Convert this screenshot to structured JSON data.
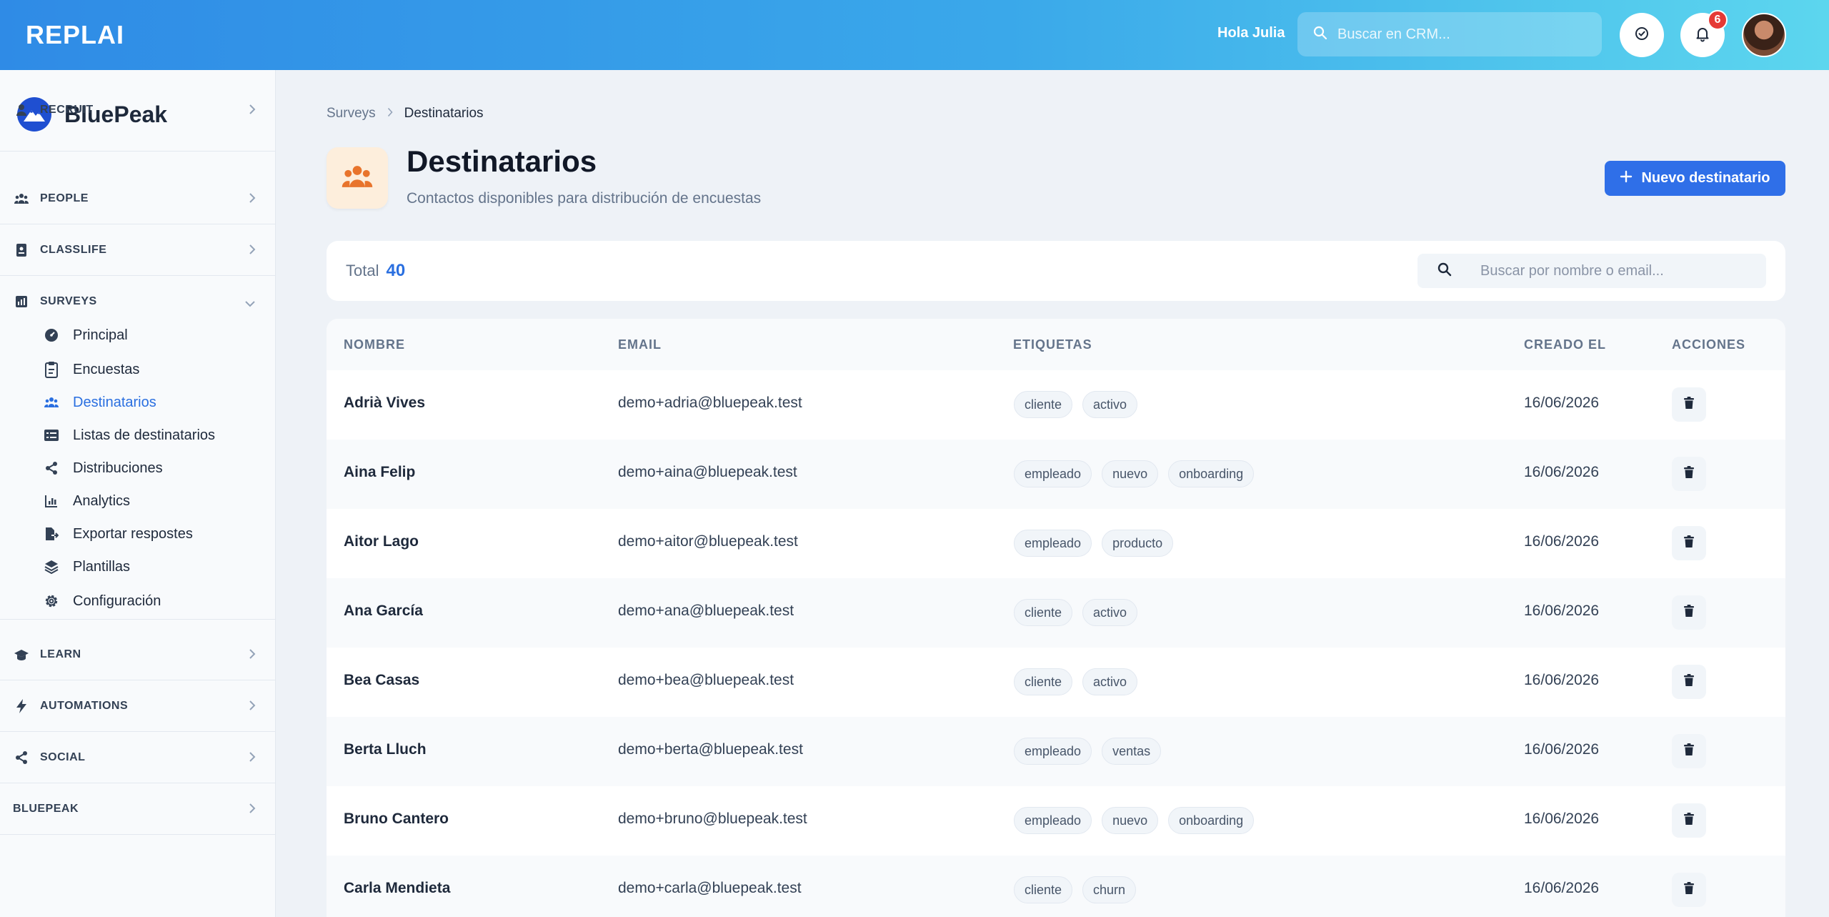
{
  "app": {
    "logo": "REPLAI",
    "greeting": "Hola Julia",
    "search_placeholder": "Buscar en CRM...",
    "notification_count": "6"
  },
  "brand": {
    "name": "BluePeak"
  },
  "sidebar": {
    "sections": [
      {
        "label": "RECRUIT",
        "icon": "user-tie-icon"
      },
      {
        "label": "PEOPLE",
        "icon": "people-group-icon"
      },
      {
        "label": "CLASSLIFE",
        "icon": "id-badge-icon"
      },
      {
        "label": "SURVEYS",
        "icon": "bar-chart-icon",
        "expanded": true
      },
      {
        "label": "LEARN",
        "icon": "graduation-cap-icon"
      },
      {
        "label": "AUTOMATIONS",
        "icon": "bolt-icon"
      },
      {
        "label": "SOCIAL",
        "icon": "share-icon"
      },
      {
        "label": "BLUEPEAK",
        "icon": ""
      }
    ],
    "survey_items": [
      {
        "label": "Principal",
        "icon": "gauge-icon"
      },
      {
        "label": "Encuestas",
        "icon": "clipboard-icon"
      },
      {
        "label": "Destinatarios",
        "icon": "people-group-icon",
        "active": true
      },
      {
        "label": "Listas de destinatarios",
        "icon": "list-icon"
      },
      {
        "label": "Distribuciones",
        "icon": "share-icon"
      },
      {
        "label": "Analytics",
        "icon": "chart-icon"
      },
      {
        "label": "Exportar respostes",
        "icon": "file-export-icon"
      },
      {
        "label": "Plantillas",
        "icon": "layers-icon"
      },
      {
        "label": "Configuración",
        "icon": "gear-icon"
      }
    ]
  },
  "breadcrumb": {
    "parent": "Surveys",
    "current": "Destinatarios"
  },
  "page": {
    "title": "Destinatarios",
    "subtitle": "Contactos disponibles para distribución de encuestas",
    "new_button": "Nuevo destinatario"
  },
  "toolbar": {
    "total_label": "Total",
    "total_value": "40",
    "search_placeholder": "Buscar por nombre o email..."
  },
  "table": {
    "headers": [
      "NOMBRE",
      "EMAIL",
      "ETIQUETAS",
      "CREADO EL",
      "ACCIONES"
    ],
    "rows": [
      {
        "name": "Adrià Vives",
        "email": "demo+adria@bluepeak.test",
        "tags": [
          "cliente",
          "activo"
        ],
        "created": "16/06/2026"
      },
      {
        "name": "Aina Felip",
        "email": "demo+aina@bluepeak.test",
        "tags": [
          "empleado",
          "nuevo",
          "onboarding"
        ],
        "created": "16/06/2026"
      },
      {
        "name": "Aitor Lago",
        "email": "demo+aitor@bluepeak.test",
        "tags": [
          "empleado",
          "producto"
        ],
        "created": "16/06/2026"
      },
      {
        "name": "Ana García",
        "email": "demo+ana@bluepeak.test",
        "tags": [
          "cliente",
          "activo"
        ],
        "created": "16/06/2026"
      },
      {
        "name": "Bea Casas",
        "email": "demo+bea@bluepeak.test",
        "tags": [
          "cliente",
          "activo"
        ],
        "created": "16/06/2026"
      },
      {
        "name": "Berta Lluch",
        "email": "demo+berta@bluepeak.test",
        "tags": [
          "empleado",
          "ventas"
        ],
        "created": "16/06/2026"
      },
      {
        "name": "Bruno Cantero",
        "email": "demo+bruno@bluepeak.test",
        "tags": [
          "empleado",
          "nuevo",
          "onboarding"
        ],
        "created": "16/06/2026"
      },
      {
        "name": "Carla Mendieta",
        "email": "demo+carla@bluepeak.test",
        "tags": [
          "cliente",
          "churn"
        ],
        "created": "16/06/2026"
      }
    ]
  },
  "colors": {
    "accent": "#2f6fe8",
    "active_nav": "#2a6fe0",
    "page_icon": "#e8742c",
    "badge": "#e53935"
  }
}
